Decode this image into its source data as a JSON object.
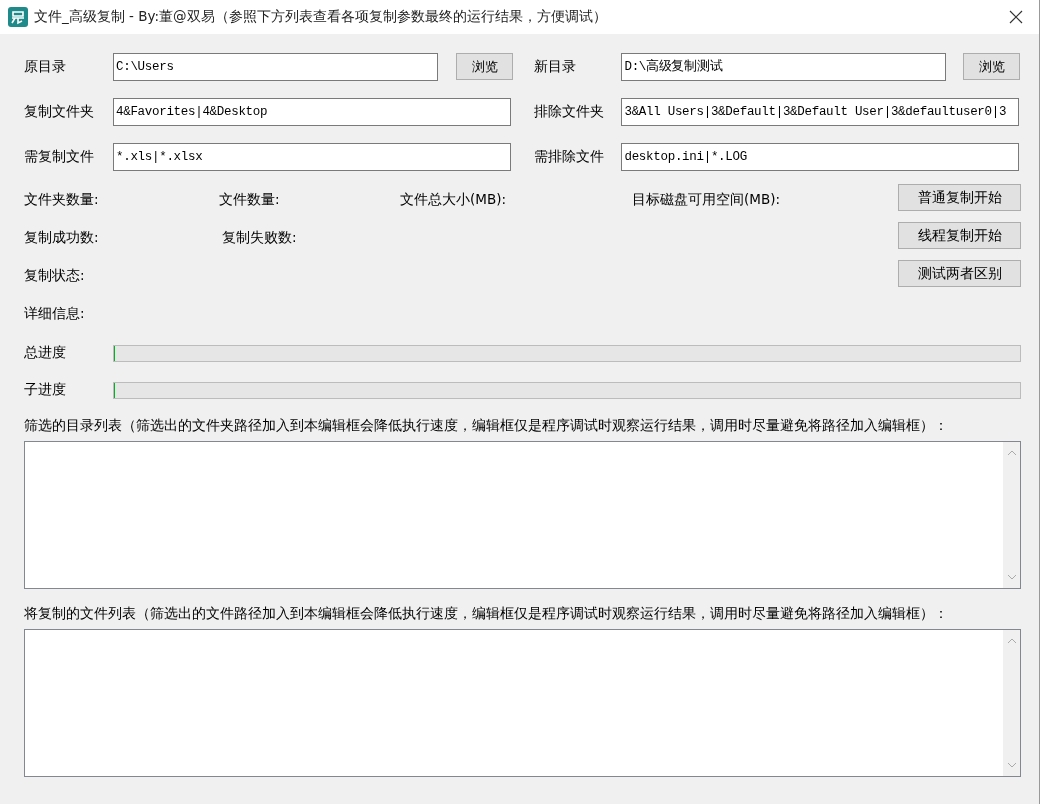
{
  "window": {
    "title": "文件_高级复制 - By:董@双易（参照下方列表查看各项复制参数最终的运行结果，方便调试）"
  },
  "fields": [
    {
      "label": "原目录",
      "value": "C:\\Users",
      "button": "浏览"
    },
    {
      "label": "新目录",
      "value": "D:\\高级复制测试",
      "button": "浏览"
    },
    {
      "label": "复制文件夹",
      "value": "4&Favorites|4&Desktop"
    },
    {
      "label": "排除文件夹",
      "value": "3&All Users|3&Default|3&Default User|3&defaultuser0|3"
    },
    {
      "label": "需复制文件",
      "value": "*.xls|*.xlsx"
    },
    {
      "label": "需排除文件",
      "value": "desktop.ini|*.LOG"
    }
  ],
  "stats_rows": [
    [
      "文件夹数量:",
      "文件数量:",
      "文件总大小(MB):",
      "目标磁盘可用空间(MB):"
    ],
    [
      "复制成功数:",
      "复制失败数:"
    ],
    [
      "复制状态:"
    ],
    [
      "详细信息:"
    ]
  ],
  "action_buttons": [
    "普通复制开始",
    "线程复制开始",
    "测试两者区别"
  ],
  "progress": [
    {
      "label": "总进度",
      "level": 0
    },
    {
      "label": "子进度",
      "level": 0
    }
  ],
  "lists": [
    {
      "label": "筛选的目录列表（筛选出的文件夹路径加入到本编辑框会降低执行速度，编辑框仅是程序调试时观察运行结果，调用时尽量避免将路径加入编辑框）："
    },
    {
      "label": "将复制的文件列表（筛选出的文件路径加入到本编辑框会降低执行速度，编辑框仅是程序调试时观察运行结果，调用时尽量避免将路径加入编辑框）："
    }
  ]
}
